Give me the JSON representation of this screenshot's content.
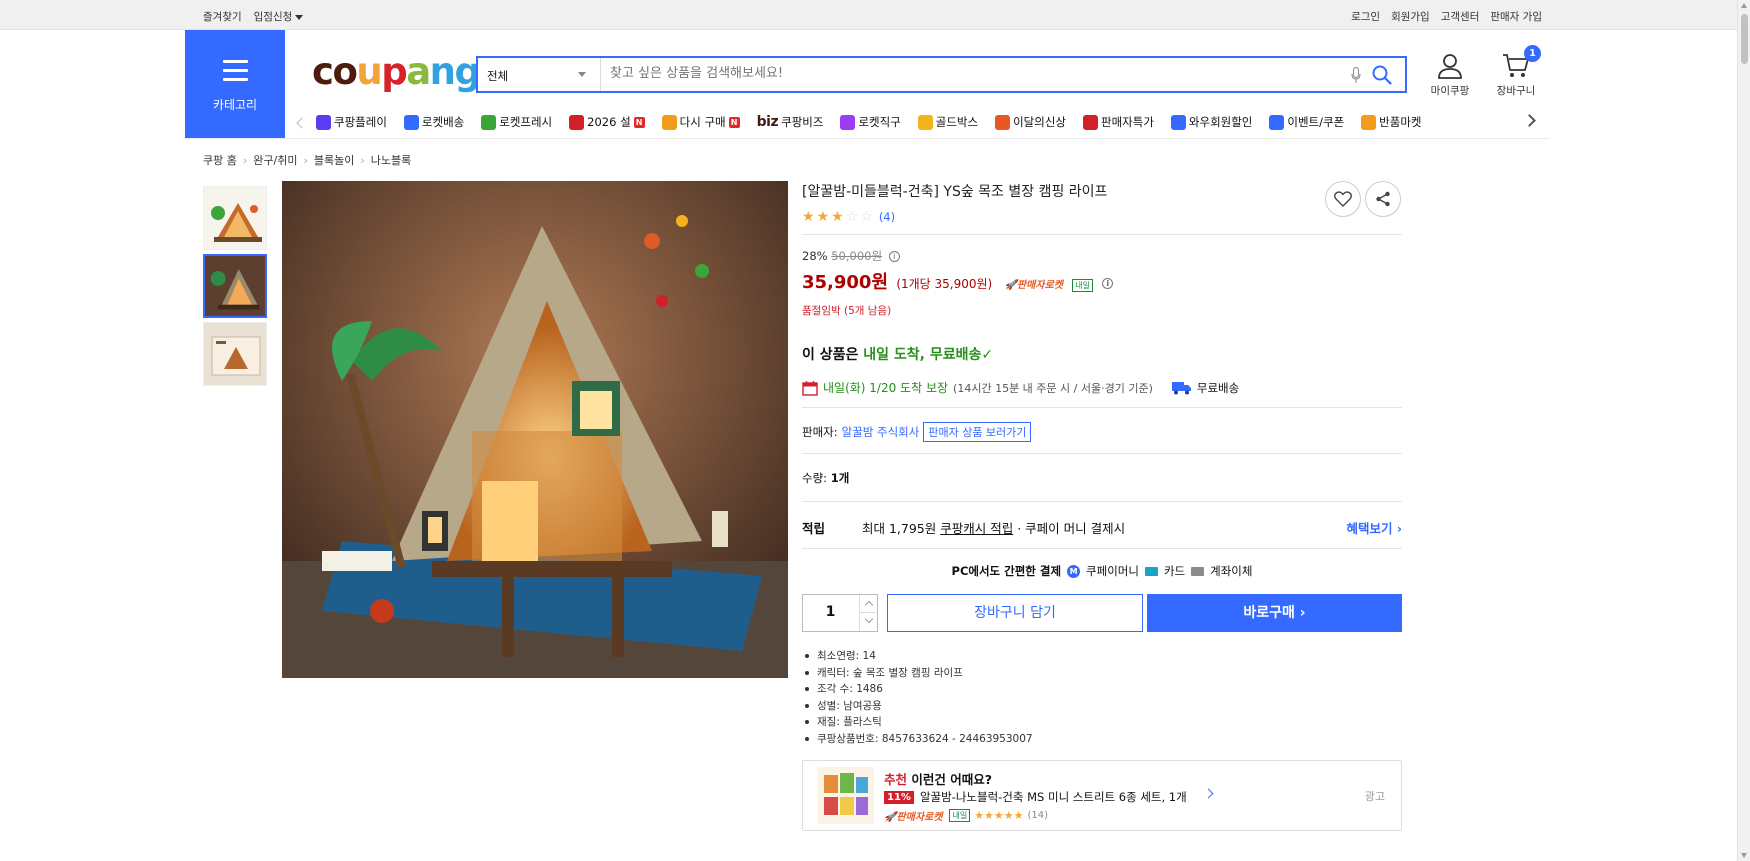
{
  "topbar": {
    "left": [
      "즐겨찾기",
      "입점신청"
    ],
    "right": [
      "로그인",
      "회원가입",
      "고객센터",
      "판매자 가입"
    ]
  },
  "header": {
    "category_label": "카테고리",
    "logo": "coupang",
    "search_category": "전체",
    "search_placeholder": "찾고 싶은 상품을 검색해보세요!",
    "mycoupang": "마이쿠팡",
    "cart": "장바구니",
    "cart_count": "1"
  },
  "nav": [
    {
      "label": "쿠팡플레이",
      "icon": "play-icon",
      "color": "#5a3cf2"
    },
    {
      "label": "로켓배송",
      "icon": "rocket-icon",
      "color": "#346aff"
    },
    {
      "label": "로켓프레시",
      "icon": "rocket-fresh-icon",
      "color": "#3aa63a"
    },
    {
      "label": "2026 설",
      "icon": "gift-icon",
      "color": "#d2202a",
      "badge": "N"
    },
    {
      "label": "다시 구매",
      "icon": "repurchase-icon",
      "color": "#f29b1c",
      "badge": "N"
    },
    {
      "label": "쿠팡비즈",
      "prefix": "biz"
    },
    {
      "label": "로켓직구",
      "icon": "globe-icon",
      "color": "#9b3cf2"
    },
    {
      "label": "골드박스",
      "icon": "goldbox-icon",
      "color": "#f2b31c"
    },
    {
      "label": "이달의신상",
      "icon": "new-icon",
      "color": "#e85823"
    },
    {
      "label": "판매자특가",
      "icon": "sale-icon",
      "color": "#d2202a"
    },
    {
      "label": "와우회원할인",
      "icon": "wow-icon",
      "color": "#346aff"
    },
    {
      "label": "이벤트/쿠폰",
      "icon": "coupon-icon",
      "color": "#346aff"
    },
    {
      "label": "반품마켓",
      "icon": "market-icon",
      "color": "#f29b1c"
    }
  ],
  "breadcrumb": [
    "쿠팡 홈",
    "완구/취미",
    "블록놀이",
    "나노블록"
  ],
  "product": {
    "title": "[알꿀밤-미들블럭-건축] YS숲 목조 별장 캠핑 라이프",
    "rating": 3,
    "review_count": "(4)",
    "discount": "28%",
    "original_price": "50,000원",
    "price": "35,900원",
    "unit_price": "(1개당 35,900원)",
    "seller_rocket": "판매자로켓",
    "tomorrow_badge": "내일",
    "stock": "품절임박 (5개 남음)",
    "arrival_prefix": "이 상품은 ",
    "arrival_green": "내일 도착, 무료배송",
    "arrival_check": "✓",
    "delivery_date": "내일(화) 1/20 도착 보장",
    "delivery_note": "(14시간 15분 내 주문 시 / 서울⋅경기 기준)",
    "free_shipping": "무료배송",
    "seller_label": "판매자:",
    "seller_name": "알꿀밤 주식회사",
    "seller_link": "판매자 상품 보러가기",
    "qty_label": "수량:",
    "qty_value": "1개",
    "reward_label": "적립",
    "reward_text1": "최대 1,795원",
    "reward_text2": "쿠팡캐시 적립",
    "reward_text3": "· 쿠페이 머니 결제시",
    "reward_more": "혜택보기",
    "pc_pay": "PC에서도 간편한 결제",
    "pay_methods": [
      "쿠페이머니",
      "카드",
      "계좌이체"
    ],
    "quantity": "1",
    "btn_cart": "장바구니 담기",
    "btn_buy": "바로구매",
    "specs": [
      "최소연령: 14",
      "캐릭터: 숲 목조 별장 캠핑 라이프",
      "조각 수: 1486",
      "성별: 남여공용",
      "재질: 플라스틱",
      "쿠팡상품번호: 8457633624 - 24463953007"
    ]
  },
  "recommend": {
    "title_red": "추천",
    "title": " 이런건 어때요?",
    "pct": "11%",
    "name": "알꿀밤-나노블럭-건축 MS 미니 스트리트 6종 세트, 1개",
    "seller_rocket": "판매자로켓",
    "tomorrow_badge": "내일",
    "rating_stars": "★★★★★",
    "count": "(14)",
    "ad": "광고"
  },
  "colors": {
    "accent": "#346aff",
    "price_red": "#ae0000",
    "green": "#248f19"
  }
}
